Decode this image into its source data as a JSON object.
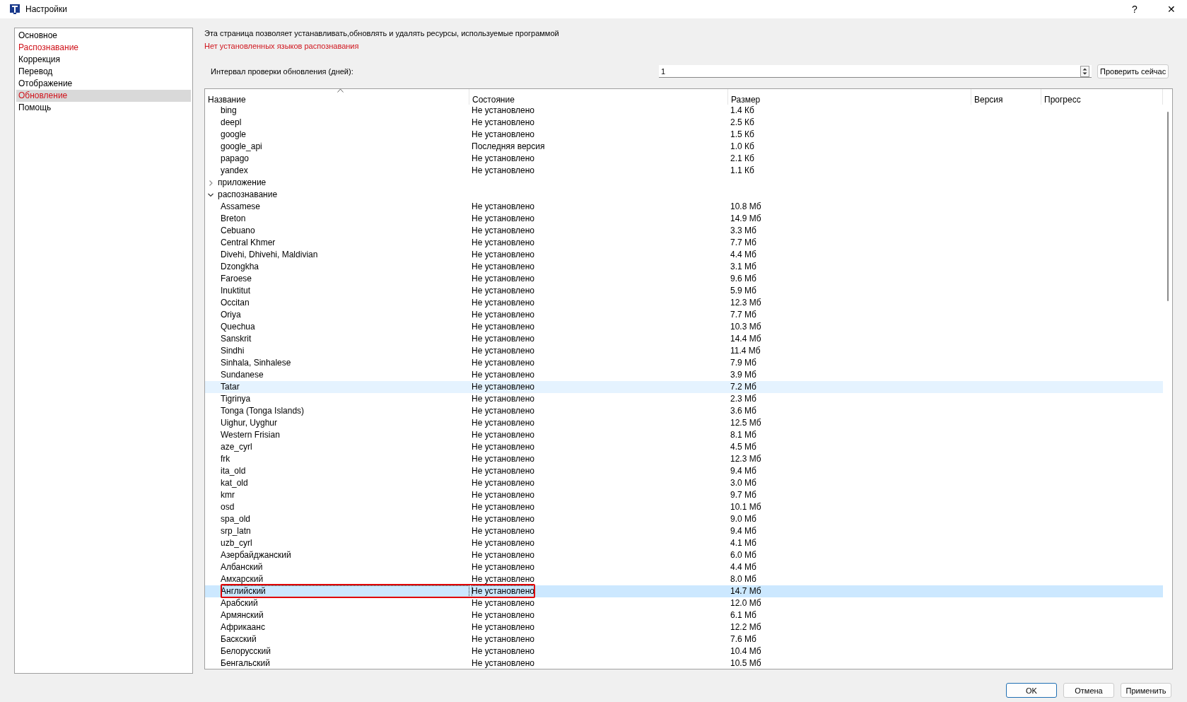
{
  "window": {
    "title": "Настройки",
    "help": "?",
    "close": "✕"
  },
  "sidebar": {
    "items": [
      {
        "label": "Основное",
        "selected": false,
        "warning": false
      },
      {
        "label": "Распознавание",
        "selected": false,
        "warning": true
      },
      {
        "label": "Коррекция",
        "selected": false,
        "warning": false
      },
      {
        "label": "Перевод",
        "selected": false,
        "warning": false
      },
      {
        "label": "Отображение",
        "selected": false,
        "warning": false
      },
      {
        "label": "Обновление",
        "selected": true,
        "warning": true
      },
      {
        "label": "Помощь",
        "selected": false,
        "warning": false
      }
    ]
  },
  "description": "Эта страница позволяет устанавливать,обновлять и удалять ресурсы, используемые программой",
  "warning": "Нет установленных языков распознавания",
  "interval": {
    "label": "Интервал проверки обновления (дней):",
    "value": "1",
    "button": "Проверить сейчас"
  },
  "table": {
    "columns": [
      {
        "label": "Название",
        "sorted": true
      },
      {
        "label": "Состояние",
        "sorted": false
      },
      {
        "label": "Размер",
        "sorted": false
      },
      {
        "label": "Версия",
        "sorted": false
      },
      {
        "label": "Прогресс",
        "sorted": false
      }
    ],
    "rows": [
      {
        "kind": "continued",
        "children": [
          {
            "name": "bing",
            "state": "Не установлено",
            "size": "1.4 Кб",
            "selected": false,
            "hovered": false,
            "boxed": false
          },
          {
            "name": "deepl",
            "state": "Не установлено",
            "size": "2.5 Кб",
            "selected": false,
            "hovered": false,
            "boxed": false
          },
          {
            "name": "google",
            "state": "Не установлено",
            "size": "1.5 Кб",
            "selected": false,
            "hovered": false,
            "boxed": false
          },
          {
            "name": "google_api",
            "state": "Последняя версия",
            "size": "1.0 Кб",
            "selected": false,
            "hovered": false,
            "boxed": false
          },
          {
            "name": "papago",
            "state": "Не установлено",
            "size": "2.1 Кб",
            "selected": false,
            "hovered": false,
            "boxed": false
          },
          {
            "name": "yandex",
            "state": "Не установлено",
            "size": "1.1 Кб",
            "selected": false,
            "hovered": false,
            "boxed": false
          }
        ]
      },
      {
        "kind": "group",
        "name": "приложение",
        "expanded": false,
        "children": []
      },
      {
        "kind": "group",
        "name": "распознавание",
        "expanded": true,
        "children": [
          {
            "name": "Assamese",
            "state": "Не установлено",
            "size": "10.8 Мб",
            "selected": false,
            "hovered": false,
            "boxed": false
          },
          {
            "name": "Breton",
            "state": "Не установлено",
            "size": "14.9 Мб",
            "selected": false,
            "hovered": false,
            "boxed": false
          },
          {
            "name": "Cebuano",
            "state": "Не установлено",
            "size": "3.3 Мб",
            "selected": false,
            "hovered": false,
            "boxed": false
          },
          {
            "name": "Central Khmer",
            "state": "Не установлено",
            "size": "7.7 Мб",
            "selected": false,
            "hovered": false,
            "boxed": false
          },
          {
            "name": "Divehi, Dhivehi, Maldivian",
            "state": "Не установлено",
            "size": "4.4 Мб",
            "selected": false,
            "hovered": false,
            "boxed": false
          },
          {
            "name": "Dzongkha",
            "state": "Не установлено",
            "size": "3.1 Мб",
            "selected": false,
            "hovered": false,
            "boxed": false
          },
          {
            "name": "Faroese",
            "state": "Не установлено",
            "size": "9.6 Мб",
            "selected": false,
            "hovered": false,
            "boxed": false
          },
          {
            "name": "Inuktitut",
            "state": "Не установлено",
            "size": "5.9 Мб",
            "selected": false,
            "hovered": false,
            "boxed": false
          },
          {
            "name": "Occitan",
            "state": "Не установлено",
            "size": "12.3 Мб",
            "selected": false,
            "hovered": false,
            "boxed": false
          },
          {
            "name": "Oriya",
            "state": "Не установлено",
            "size": "7.7 Мб",
            "selected": false,
            "hovered": false,
            "boxed": false
          },
          {
            "name": "Quechua",
            "state": "Не установлено",
            "size": "10.3 Мб",
            "selected": false,
            "hovered": false,
            "boxed": false
          },
          {
            "name": "Sanskrit",
            "state": "Не установлено",
            "size": "14.4 Мб",
            "selected": false,
            "hovered": false,
            "boxed": false
          },
          {
            "name": "Sindhi",
            "state": "Не установлено",
            "size": "11.4 Мб",
            "selected": false,
            "hovered": false,
            "boxed": false
          },
          {
            "name": "Sinhala, Sinhalese",
            "state": "Не установлено",
            "size": "7.9 Мб",
            "selected": false,
            "hovered": false,
            "boxed": false
          },
          {
            "name": "Sundanese",
            "state": "Не установлено",
            "size": "3.9 Мб",
            "selected": false,
            "hovered": false,
            "boxed": false
          },
          {
            "name": "Tatar",
            "state": "Не установлено",
            "size": "7.2 Мб",
            "selected": false,
            "hovered": true,
            "boxed": false
          },
          {
            "name": "Tigrinya",
            "state": "Не установлено",
            "size": "2.3 Мб",
            "selected": false,
            "hovered": false,
            "boxed": false
          },
          {
            "name": "Tonga (Tonga Islands)",
            "state": "Не установлено",
            "size": "3.6 Мб",
            "selected": false,
            "hovered": false,
            "boxed": false
          },
          {
            "name": "Uighur, Uyghur",
            "state": "Не установлено",
            "size": "12.5 Мб",
            "selected": false,
            "hovered": false,
            "boxed": false
          },
          {
            "name": "Western Frisian",
            "state": "Не установлено",
            "size": "8.1 Мб",
            "selected": false,
            "hovered": false,
            "boxed": false
          },
          {
            "name": "aze_cyrl",
            "state": "Не установлено",
            "size": "4.5 Мб",
            "selected": false,
            "hovered": false,
            "boxed": false
          },
          {
            "name": "frk",
            "state": "Не установлено",
            "size": "12.3 Мб",
            "selected": false,
            "hovered": false,
            "boxed": false
          },
          {
            "name": "ita_old",
            "state": "Не установлено",
            "size": "9.4 Мб",
            "selected": false,
            "hovered": false,
            "boxed": false
          },
          {
            "name": "kat_old",
            "state": "Не установлено",
            "size": "3.0 Мб",
            "selected": false,
            "hovered": false,
            "boxed": false
          },
          {
            "name": "kmr",
            "state": "Не установлено",
            "size": "9.7 Мб",
            "selected": false,
            "hovered": false,
            "boxed": false
          },
          {
            "name": "osd",
            "state": "Не установлено",
            "size": "10.1 Мб",
            "selected": false,
            "hovered": false,
            "boxed": false
          },
          {
            "name": "spa_old",
            "state": "Не установлено",
            "size": "9.0 Мб",
            "selected": false,
            "hovered": false,
            "boxed": false
          },
          {
            "name": "srp_latn",
            "state": "Не установлено",
            "size": "9.4 Мб",
            "selected": false,
            "hovered": false,
            "boxed": false
          },
          {
            "name": "uzb_cyrl",
            "state": "Не установлено",
            "size": "4.1 Мб",
            "selected": false,
            "hovered": false,
            "boxed": false
          },
          {
            "name": "Азербайджанский",
            "state": "Не установлено",
            "size": "6.0 Мб",
            "selected": false,
            "hovered": false,
            "boxed": false
          },
          {
            "name": "Албанский",
            "state": "Не установлено",
            "size": "4.4 Мб",
            "selected": false,
            "hovered": false,
            "boxed": false
          },
          {
            "name": "Амхарский",
            "state": "Не установлено",
            "size": "8.0 Мб",
            "selected": false,
            "hovered": false,
            "boxed": false
          },
          {
            "name": "Английский",
            "state": "Не установлено",
            "size": "14.7 Мб",
            "selected": true,
            "hovered": false,
            "boxed": true
          },
          {
            "name": "Арабский",
            "state": "Не установлено",
            "size": "12.0 Мб",
            "selected": false,
            "hovered": false,
            "boxed": false
          },
          {
            "name": "Армянский",
            "state": "Не установлено",
            "size": "6.1 Мб",
            "selected": false,
            "hovered": false,
            "boxed": false
          },
          {
            "name": "Африкаанс",
            "state": "Не установлено",
            "size": "12.2 Мб",
            "selected": false,
            "hovered": false,
            "boxed": false
          },
          {
            "name": "Баскский",
            "state": "Не установлено",
            "size": "7.6 Мб",
            "selected": false,
            "hovered": false,
            "boxed": false
          },
          {
            "name": "Белорусский",
            "state": "Не установлено",
            "size": "10.4 Мб",
            "selected": false,
            "hovered": false,
            "boxed": false
          },
          {
            "name": "Бенгальский",
            "state": "Не установлено",
            "size": "10.5 Мб",
            "selected": false,
            "hovered": false,
            "boxed": false
          }
        ]
      }
    ]
  },
  "buttons": [
    {
      "label": "OK",
      "default": true
    },
    {
      "label": "Отмена",
      "default": false
    },
    {
      "label": "Применить",
      "default": false
    }
  ]
}
